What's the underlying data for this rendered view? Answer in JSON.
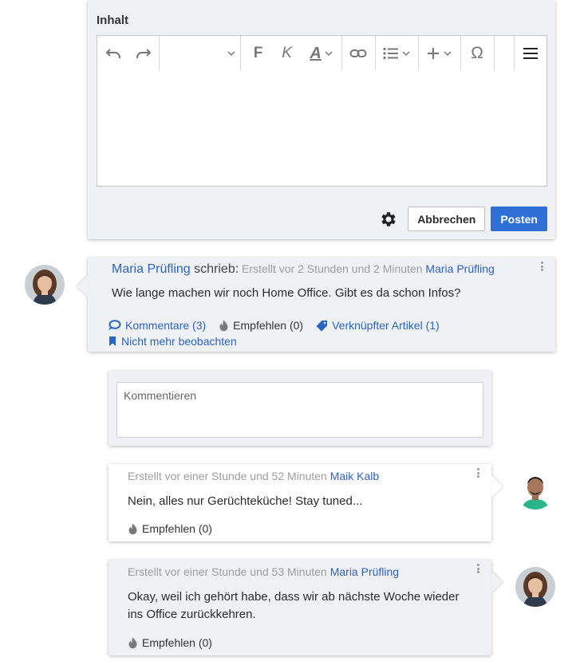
{
  "editor": {
    "label": "Inhalt",
    "icons": [
      "undo-icon",
      "redo-icon",
      "chevron-down-icon",
      "bold-icon",
      "italic-icon",
      "font-color-icon",
      "link-icon",
      "list-icon",
      "plus-icon",
      "omega-icon",
      "hamburger-menu-icon"
    ],
    "bold_glyph": "F",
    "italic_glyph": "K",
    "color_glyph": "A",
    "omega_glyph": "Ω",
    "settings_icon": "gear-icon",
    "cancel_label": "Abbrechen",
    "post_label": "Posten"
  },
  "post": {
    "author": "Maria Prüfling",
    "wrote": " schrieb:",
    "created": " Erstellt vor 2 Stunden und 2 Minuten ",
    "created_by": "Maria Prüfling",
    "text": "Wie lange machen wir noch Home Office. Gibt es da schon Infos?",
    "comments_label": "Kommentare (3)",
    "recommend_label": "Empfehlen (0)",
    "linked_article_label": "Verknüpfter Artikel (1)",
    "unwatch_label": "Nicht mehr beobachten"
  },
  "comment_box": {
    "placeholder": "Kommentieren"
  },
  "replies": [
    {
      "created": "Erstellt vor einer Stunde und 52 Minuten ",
      "author": "Maik Kalb",
      "text": "Nein, alles nur Gerüchteküche! Stay tuned...",
      "recommend_label": "Empfehlen (0)"
    },
    {
      "created": "Erstellt vor einer Stunde und 53 Minuten ",
      "author": "Maria Prüfling",
      "text": "Okay, weil ich gehört habe, dass wir ab nächste Woche wieder ins Office zurückkehren.",
      "recommend_label": "Empfehlen (0)"
    }
  ],
  "colors": {
    "accent": "#2f6fd6",
    "link": "#2a64c4",
    "card_grey": "#f0f1f5"
  }
}
